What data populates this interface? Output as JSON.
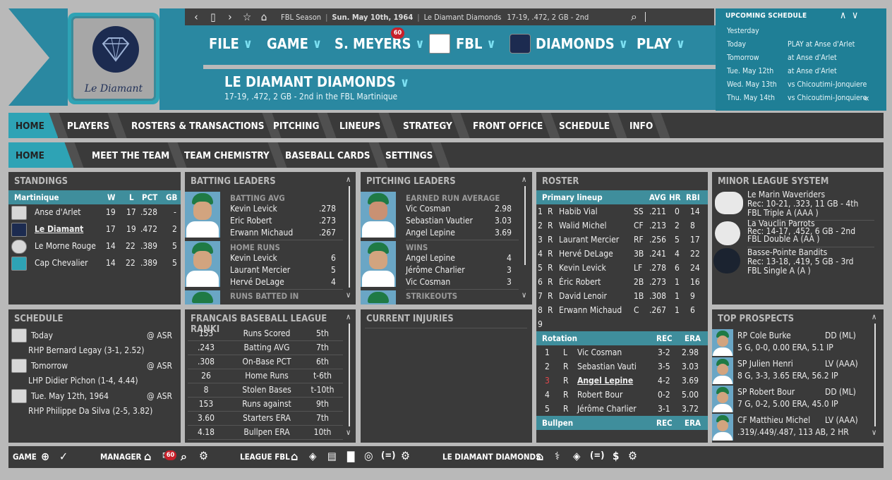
{
  "header": {
    "logo_text": "Le Diamant",
    "topbar": {
      "league": "FBL Season",
      "date": "Sun. May 10th, 1964",
      "team": "Le Diamant Diamonds",
      "record": "17-19, .472, 2 GB - 2nd"
    },
    "menu": [
      {
        "label": "FILE"
      },
      {
        "label": "GAME"
      },
      {
        "label": "S. MEYERS",
        "badge": "60"
      },
      {
        "label": "FBL"
      },
      {
        "label": "DIAMONDS"
      },
      {
        "label": "PLAY"
      }
    ],
    "team_name": "LE DIAMANT DIAMONDS",
    "team_sub": "17-19, .472, 2 GB - 2nd in the FBL Martinique"
  },
  "upcoming": {
    "title": "UPCOMING SCHEDULE",
    "rows": [
      {
        "day": "Yesterday",
        "event": ""
      },
      {
        "day": "Today",
        "event": "PLAY at Anse d'Arlet"
      },
      {
        "day": "Tomorrow",
        "event": "at Anse d'Arlet"
      },
      {
        "day": "Tue. May 12th",
        "event": "at Anse d'Arlet"
      },
      {
        "day": "Wed. May 13th",
        "event": "vs Chicoutimi-Jonquiere"
      },
      {
        "day": "Thu. May 14th",
        "event": "vs Chicoutimi-Jonquiere"
      }
    ]
  },
  "nav1": [
    "HOME",
    "PLAYERS",
    "ROSTERS & TRANSACTIONS",
    "PITCHING",
    "LINEUPS",
    "STRATEGY",
    "FRONT OFFICE",
    "SCHEDULE",
    "INFO"
  ],
  "nav2": [
    "HOME PAGE",
    "MEET THE TEAM",
    "TEAM CHEMISTRY",
    "BASEBALL CARDS",
    "SETTINGS"
  ],
  "standings": {
    "title": "STANDINGS",
    "headers": [
      "Martinique",
      "W",
      "L",
      "PCT",
      "GB"
    ],
    "rows": [
      {
        "team": "Anse d'Arlet",
        "w": "19",
        "l": "17",
        "pct": ".528",
        "gb": "-"
      },
      {
        "team": "Le Diamant",
        "w": "17",
        "l": "19",
        "pct": ".472",
        "gb": "2"
      },
      {
        "team": "Le Morne Rouge",
        "w": "14",
        "l": "22",
        "pct": ".389",
        "gb": "5"
      },
      {
        "team": "Cap Chevalier",
        "w": "14",
        "l": "22",
        "pct": ".389",
        "gb": "5"
      }
    ]
  },
  "batting_leaders": {
    "title": "BATTING LEADERS",
    "groups": [
      {
        "label": "BATTING AVG",
        "rows": [
          {
            "name": "Kevin Levick",
            "val": ".278"
          },
          {
            "name": "Eric Robert",
            "val": ".273"
          },
          {
            "name": "Erwann Michaud",
            "val": ".267"
          }
        ]
      },
      {
        "label": "HOME RUNS",
        "rows": [
          {
            "name": "Kevin Levick",
            "val": "6"
          },
          {
            "name": "Laurant Mercier",
            "val": "5"
          },
          {
            "name": "Hervé DeLage",
            "val": "4"
          }
        ]
      },
      {
        "label": "RUNS BATTED IN",
        "rows": []
      }
    ]
  },
  "pitching_leaders": {
    "title": "PITCHING LEADERS",
    "groups": [
      {
        "label": "EARNED RUN AVERAGE",
        "rows": [
          {
            "name": "Vic Cosman",
            "val": "2.98"
          },
          {
            "name": "Sebastian  Vautier",
            "val": "3.03"
          },
          {
            "name": "Angel Lepine",
            "val": "3.69"
          }
        ]
      },
      {
        "label": "WINS",
        "rows": [
          {
            "name": "Angel Lepine",
            "val": "4"
          },
          {
            "name": "Jérôme Charlier",
            "val": "3"
          },
          {
            "name": "Vic Cosman",
            "val": "3"
          }
        ]
      },
      {
        "label": "STRIKEOUTS",
        "rows": []
      }
    ]
  },
  "roster": {
    "title": "ROSTER",
    "lineup_headers": [
      "Primary lineup",
      "AVG",
      "HR",
      "RBI"
    ],
    "lineup": [
      {
        "n": "1",
        "h": "R",
        "name": "Habib Vial",
        "pos": "SS",
        "avg": ".211",
        "hr": "0",
        "rbi": "14"
      },
      {
        "n": "2",
        "h": "R",
        "name": "Walid Michel",
        "pos": "CF",
        "avg": ".213",
        "hr": "2",
        "rbi": "8"
      },
      {
        "n": "3",
        "h": "R",
        "name": "Laurant Mercier",
        "pos": "RF",
        "avg": ".256",
        "hr": "5",
        "rbi": "17"
      },
      {
        "n": "4",
        "h": "R",
        "name": "Hervé DeLage",
        "pos": "3B",
        "avg": ".241",
        "hr": "4",
        "rbi": "22"
      },
      {
        "n": "5",
        "h": "R",
        "name": "Kevin Levick",
        "pos": "LF",
        "avg": ".278",
        "hr": "6",
        "rbi": "24"
      },
      {
        "n": "6",
        "h": "R",
        "name": "Éric Robert",
        "pos": "2B",
        "avg": ".273",
        "hr": "1",
        "rbi": "16"
      },
      {
        "n": "7",
        "h": "R",
        "name": "David Lenoir",
        "pos": "1B",
        "avg": ".308",
        "hr": "1",
        "rbi": "9"
      },
      {
        "n": "8",
        "h": "R",
        "name": "Erwann Michaud",
        "pos": "C",
        "avg": ".267",
        "hr": "1",
        "rbi": "6"
      },
      {
        "n": "9",
        "h": "",
        "name": "",
        "pos": "",
        "avg": "",
        "hr": "",
        "rbi": ""
      }
    ],
    "rotation_headers": [
      "Rotation",
      "REC",
      "ERA"
    ],
    "rotation": [
      {
        "n": "1",
        "h": "L",
        "name": "Vic Cosman",
        "rec": "3-2",
        "era": "2.98"
      },
      {
        "n": "2",
        "h": "R",
        "name": "Sebastian  Vauti",
        "rec": "3-5",
        "era": "3.03"
      },
      {
        "n": "3",
        "h": "R",
        "name": "Angel Lepine",
        "rec": "4-2",
        "era": "3.69"
      },
      {
        "n": "4",
        "h": "R",
        "name": "Robert Bour",
        "rec": "0-2",
        "era": "5.00"
      },
      {
        "n": "5",
        "h": "R",
        "name": "Jérôme Charlier",
        "rec": "3-1",
        "era": "3.72"
      }
    ],
    "bullpen_headers": [
      "Bullpen",
      "REC",
      "ERA"
    ]
  },
  "minor_league": {
    "title": "MINOR LEAGUE SYSTEM",
    "teams": [
      {
        "name": "Le Marin Waveriders",
        "rec": "Rec: 10-21, .323, 11 GB - 4th",
        "level": "FBL Triple A (AAA )"
      },
      {
        "name": "La Vauclin Parrots",
        "rec": "Rec: 14-17, .452, 6 GB - 2nd",
        "level": "FBL Double A (AA )"
      },
      {
        "name": "Basse-Pointe Bandits",
        "rec": "Rec: 13-18, .419, 5 GB - 3rd",
        "level": "FBL Single A (A )"
      }
    ]
  },
  "schedule": {
    "title": "SCHEDULE",
    "rows": [
      {
        "day": "Today",
        "opp": "@ ASR",
        "pitcher": "RHP Bernard Legay (3-1, 2.52)"
      },
      {
        "day": "Tomorrow",
        "opp": "@ ASR",
        "pitcher": "LHP Didier Pichon (1-4, 4.44)"
      },
      {
        "day": "Tue. May 12th, 1964",
        "opp": "@ ASR",
        "pitcher": "RHP Philippe Da Silva (2-5, 3.82)"
      }
    ]
  },
  "rankings": {
    "title": "FRANCAIS BASEBALL LEAGUE RANKI",
    "rows": [
      {
        "val": "153",
        "stat": "Runs Scored",
        "rank": "5th"
      },
      {
        "val": ".243",
        "stat": "Batting AVG",
        "rank": "7th"
      },
      {
        "val": ".308",
        "stat": "On-Base PCT",
        "rank": "6th"
      },
      {
        "val": "26",
        "stat": "Home Runs",
        "rank": "t-6th"
      },
      {
        "val": "8",
        "stat": "Stolen Bases",
        "rank": "t-10th"
      },
      {
        "val": "153",
        "stat": "Runs against",
        "rank": "9th"
      },
      {
        "val": "3.60",
        "stat": "Starters ERA",
        "rank": "7th"
      },
      {
        "val": "4.18",
        "stat": "Bullpen ERA",
        "rank": "10th"
      }
    ]
  },
  "injuries": {
    "title": "CURRENT INJURIES"
  },
  "prospects": {
    "title": "TOP PROSPECTS",
    "rows": [
      {
        "name": "RP Cole Burke",
        "level": "DD (ML)",
        "line": "5 G, 0-0, 0.00 ERA, 5.1 IP"
      },
      {
        "name": "SP Julien Henri",
        "level": "LV (AAA)",
        "line": "8 G, 3-3, 3.65 ERA, 56.2 IP"
      },
      {
        "name": "SP Robert Bour",
        "level": "DD (ML)",
        "line": "7 G, 0-2, 5.00 ERA, 45.0 IP"
      },
      {
        "name": "CF Matthieu Michel",
        "level": "LV (AAA)",
        "line": ".319/.449/.487, 113 AB, 2 HR"
      }
    ]
  },
  "bottombar": {
    "game": "GAME",
    "manager": "MANAGER",
    "manager_badge": "60",
    "league": "LEAGUE FBL",
    "team": "LE DIAMANT DIAMONDS"
  },
  "colors": {
    "accent": "#2a88a1",
    "accent_light": "#2ea3b5",
    "panel": "#3a3a3a",
    "alert": "#c8202a"
  }
}
